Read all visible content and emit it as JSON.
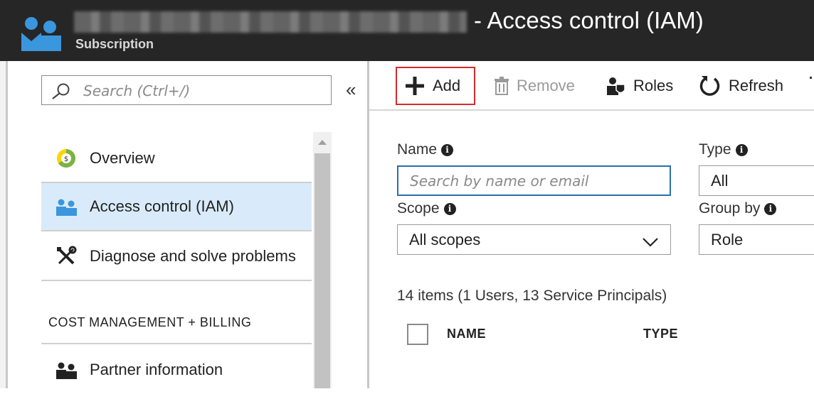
{
  "header": {
    "title": "- Access control (IAM)",
    "subtitle": "Subscription"
  },
  "sidebar": {
    "search_placeholder": "Search (Ctrl+/)",
    "collapse_glyph": "«",
    "items": [
      {
        "label": "Overview",
        "icon": "cost-overview-icon",
        "active": false
      },
      {
        "label": "Access control (IAM)",
        "icon": "users-icon",
        "active": true
      },
      {
        "label": "Diagnose and solve problems",
        "icon": "wrench-screwdriver-icon",
        "active": false
      }
    ],
    "section_heading": "COST MANAGEMENT + BILLING",
    "section_items": [
      {
        "label": "Partner information",
        "icon": "partner-users-icon"
      }
    ]
  },
  "toolbar": {
    "add_label": "Add",
    "remove_label": "Remove",
    "roles_label": "Roles",
    "refresh_label": "Refresh"
  },
  "filters": {
    "name_label": "Name",
    "name_placeholder": "Search by name or email",
    "type_label": "Type",
    "type_value": "All",
    "scope_label": "Scope",
    "scope_value": "All scopes",
    "group_label": "Group by",
    "group_value": "Role"
  },
  "results": {
    "count_text": "14 items (1 Users, 13 Service Principals)",
    "columns": [
      "NAME",
      "TYPE"
    ]
  },
  "colors": {
    "header_bg": "#262626",
    "accent": "#2a6fa8",
    "active_item_bg": "#d9ebfa",
    "highlight_border": "#d42b2b",
    "brand_blue": "#3a96dd"
  }
}
